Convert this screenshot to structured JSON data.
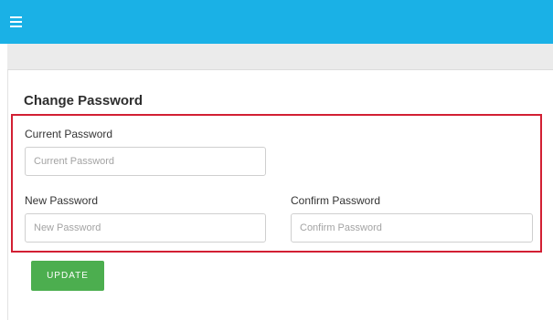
{
  "header": {
    "menu_icon": "hamburger-menu-icon",
    "bg_color": "#1ab1e6"
  },
  "form": {
    "title": "Change Password",
    "current_password": {
      "label": "Current Password",
      "placeholder": "Current Password",
      "value": ""
    },
    "new_password": {
      "label": "New Password",
      "placeholder": "New Password",
      "value": ""
    },
    "confirm_password": {
      "label": "Confirm Password",
      "placeholder": "Confirm Password",
      "value": ""
    },
    "submit_label": "UPDATE",
    "submit_color": "#4cae4f",
    "highlight_color": "#d21f33"
  }
}
